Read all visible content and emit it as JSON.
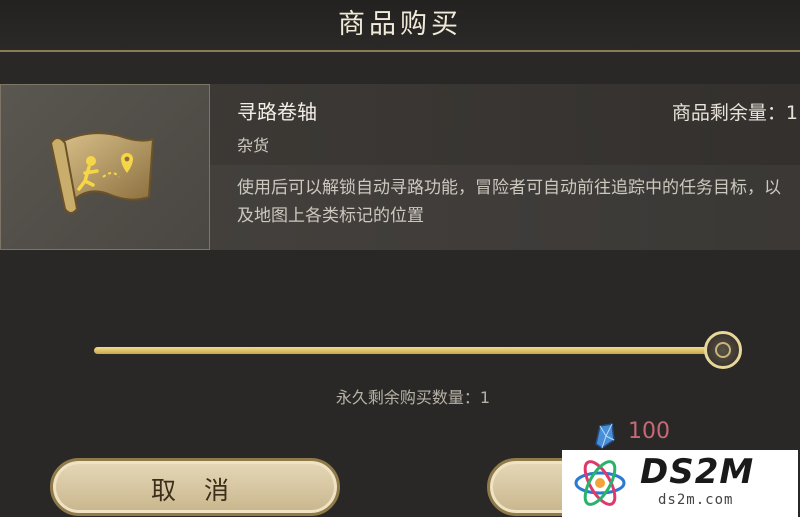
{
  "header": {
    "title": "商品购买"
  },
  "item": {
    "name": "寻路卷轴",
    "type": "杂货",
    "stock": "商品剩余量：1",
    "description": "使用后可以解锁自动寻路功能，冒险者可自动前往追踪中的任务目标，以及地图上各类标记的位置",
    "icon": "map-scroll-icon"
  },
  "purchase": {
    "quantity_fraction": 1.0,
    "remaining_label": "永久剩余购买数量：1",
    "price": "100",
    "currency_icon": "blue-crystal-icon",
    "price_color": "#c46a75"
  },
  "buttons": {
    "cancel_label": "取 消"
  },
  "watermark": {
    "main": "DS2M",
    "sub": "ds2m.com"
  },
  "colors": {
    "slider": "#e0c766",
    "button": "#d9c9a2"
  }
}
